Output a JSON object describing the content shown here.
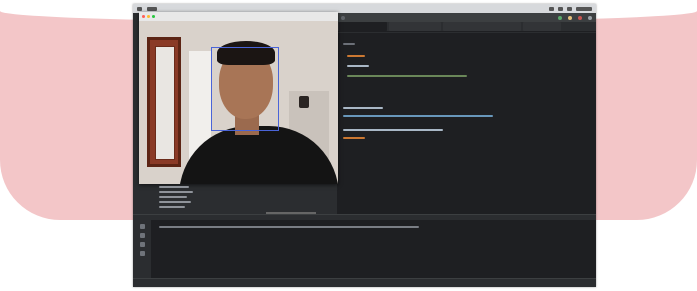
{
  "webcam_window": {
    "title": ""
  },
  "ide": {
    "tabs": [
      "",
      "",
      "",
      ""
    ],
    "active_tab": 0
  },
  "status": {
    "items": [
      "",
      "",
      "",
      ""
    ]
  },
  "colors": {
    "banner": "#f3c6c8",
    "ide_bg": "#1e1f22",
    "face_box": "#4a64d8"
  },
  "icons": [
    "apple-icon",
    "wifi-icon",
    "battery-icon",
    "search-icon",
    "run-icon",
    "debug-icon",
    "settings-icon"
  ]
}
